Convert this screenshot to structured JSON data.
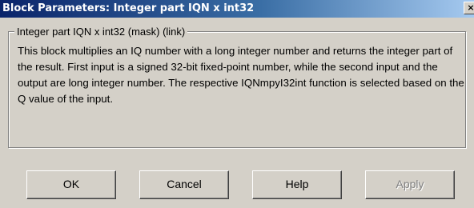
{
  "window": {
    "title": "Block Parameters: Integer part IQN x int32",
    "close_glyph": "×"
  },
  "group": {
    "legend": "Integer part IQN x int32 (mask) (link)",
    "description": "This block multiplies an IQ number with a long integer number and returns the integer part of the result. First input is a signed 32-bit fixed-point number, while the second input and the output are long integer number. The respective IQNmpyI32int function is selected based on the Q value of the input."
  },
  "buttons": {
    "ok": "OK",
    "cancel": "Cancel",
    "help": "Help",
    "apply": "Apply"
  },
  "colors": {
    "titlebar_start": "#0a246a",
    "titlebar_end": "#a6caf0",
    "window_face": "#d4d0c8",
    "disabled_text": "#808080"
  }
}
